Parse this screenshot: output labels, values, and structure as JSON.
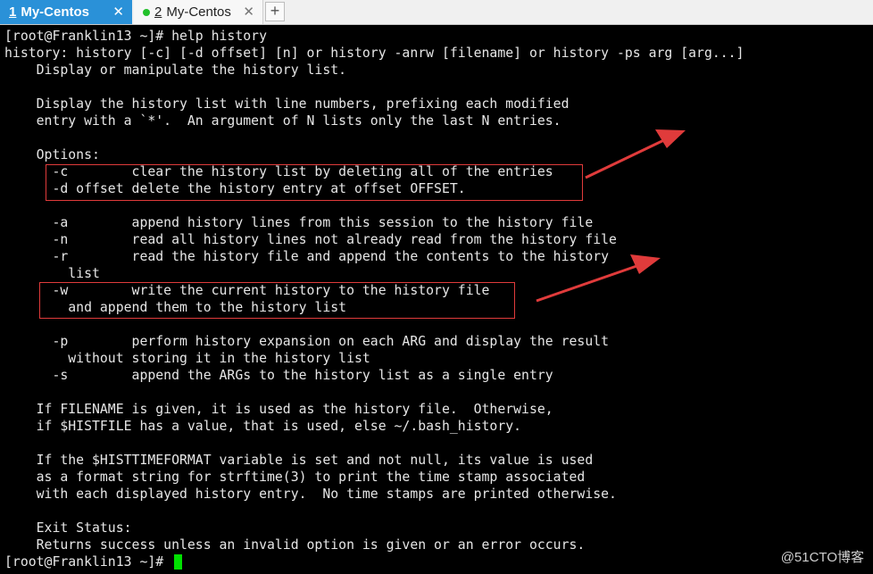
{
  "tabs": [
    {
      "number": "1",
      "title": "My-Centos",
      "close": "✕"
    },
    {
      "number": "2",
      "title": "My-Centos",
      "close": "✕"
    }
  ],
  "add_tab_label": "+",
  "terminal": {
    "lines": [
      "[root@Franklin13 ~]# help history",
      "history: history [-c] [-d offset] [n] or history -anrw [filename] or history -ps arg [arg...]",
      "    Display or manipulate the history list.",
      "",
      "    Display the history list with line numbers, prefixing each modified",
      "    entry with a `*'.  An argument of N lists only the last N entries.",
      "",
      "    Options:",
      "      -c        clear the history list by deleting all of the entries",
      "      -d offset delete the history entry at offset OFFSET.",
      "",
      "      -a        append history lines from this session to the history file",
      "      -n        read all history lines not already read from the history file",
      "      -r        read the history file and append the contents to the history",
      "        list",
      "      -w        write the current history to the history file",
      "        and append them to the history list",
      "",
      "      -p        perform history expansion on each ARG and display the result",
      "        without storing it in the history list",
      "      -s        append the ARGs to the history list as a single entry",
      "",
      "    If FILENAME is given, it is used as the history file.  Otherwise,",
      "    if $HISTFILE has a value, that is used, else ~/.bash_history.",
      "",
      "    If the $HISTTIMEFORMAT variable is set and not null, its value is used",
      "    as a format string for strftime(3) to print the time stamp associated",
      "    with each displayed history entry.  No time stamps are printed otherwise.",
      "",
      "    Exit Status:",
      "    Returns success unless an invalid option is given or an error occurs.",
      "[root@Franklin13 ~]# "
    ]
  },
  "watermark": "@51CTO博客",
  "colors": {
    "tab_active_bg": "#2a91d8",
    "tab_dot": "#22c02a",
    "terminal_bg": "#000000",
    "terminal_fg": "#e6e6e6",
    "cursor": "#00e000",
    "annotation": "#e03b3b"
  }
}
